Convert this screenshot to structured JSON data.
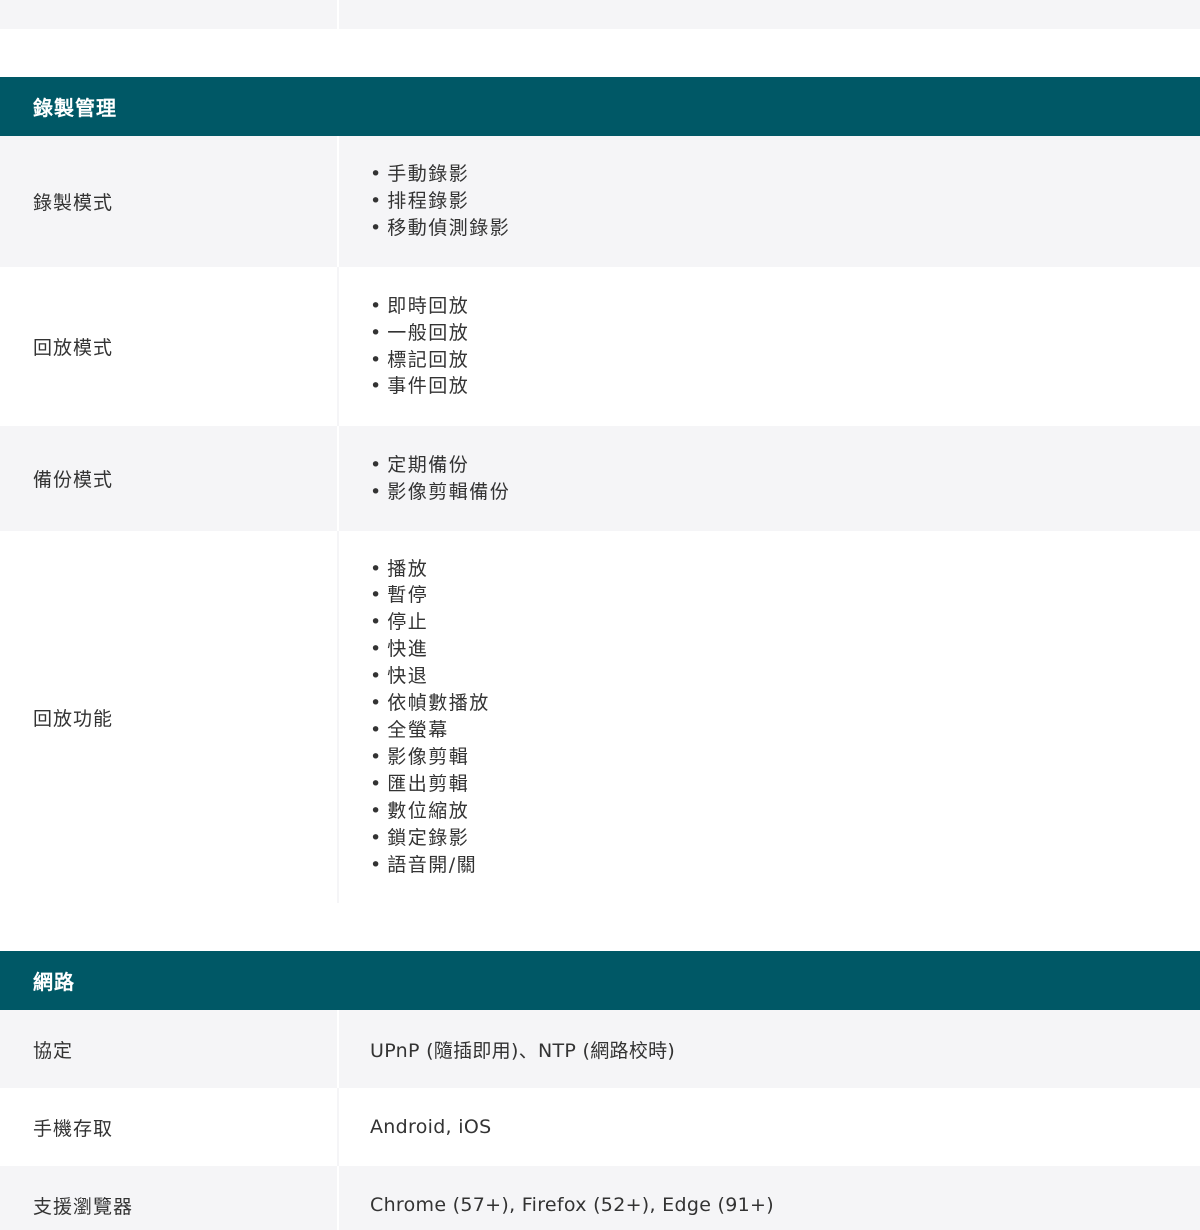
{
  "recording": {
    "header": "錄製管理",
    "rows": [
      {
        "label": "錄製模式",
        "items": [
          "手動錄影",
          "排程錄影",
          "移動偵測錄影"
        ]
      },
      {
        "label": "回放模式",
        "items": [
          "即時回放",
          "一般回放",
          "標記回放",
          "事件回放"
        ]
      },
      {
        "label": "備份模式",
        "items": [
          "定期備份",
          "影像剪輯備份"
        ]
      },
      {
        "label": "回放功能",
        "items": [
          "播放",
          "暫停",
          "停止",
          "快進",
          "快退",
          "依幀數播放",
          "全螢幕",
          "影像剪輯",
          "匯出剪輯",
          "數位縮放",
          "鎖定錄影",
          "語音開/關"
        ]
      }
    ]
  },
  "network": {
    "header": "網路",
    "rows": [
      {
        "label": "協定",
        "value": "UPnP (隨插即用)、NTP (網路校時)"
      },
      {
        "label": "手機存取",
        "value": "Android, iOS"
      },
      {
        "label": "支援瀏覽器",
        "value": "Chrome (57+), Firefox (52+), Edge (91+)"
      }
    ]
  }
}
